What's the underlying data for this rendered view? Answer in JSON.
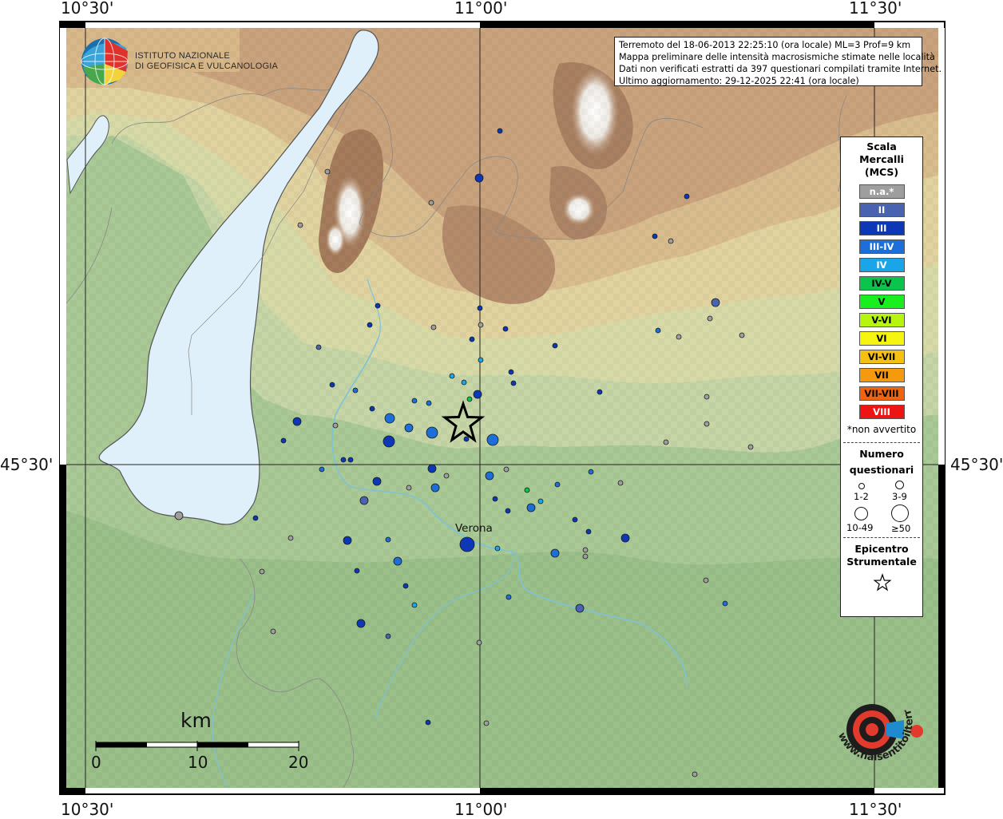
{
  "map": {
    "coords": {
      "top": [
        "10°30'",
        "11°00'",
        "11°30'"
      ],
      "bottom": [
        "10°30'",
        "11°00'",
        "11°30'"
      ],
      "left": "45°30'",
      "right": "45°30'"
    },
    "city": "Verona"
  },
  "logo": {
    "line1": "ISTITUTO NAZIONALE",
    "line2": "DI GEOFISICA E VULCANOLOGIA"
  },
  "info": {
    "line1": "Terremoto del 18-06-2013 22:25:10 (ora locale) ML=3 Prof=9 km",
    "line2": "Mappa preliminare delle intensità macrosismiche stimate nelle località",
    "line3": "Dati non verificati estratti da 397 questionari compilati tramite Internet.",
    "line4": "Ultimo aggiornamento: 29-12-2025 22:41 (ora locale)"
  },
  "legend": {
    "title": [
      "Scala",
      "Mercalli",
      "(MCS)"
    ],
    "scale": [
      {
        "label": "n.a.*",
        "color": "#9e9e9e",
        "text": "#ffffff"
      },
      {
        "label": "II",
        "color": "#4a63b0",
        "text": "#ffffff"
      },
      {
        "label": "III",
        "color": "#0c38b8",
        "text": "#ffffff"
      },
      {
        "label": "III-IV",
        "color": "#1c6fd8",
        "text": "#ffffff"
      },
      {
        "label": "IV",
        "color": "#19a5e8",
        "text": "#ffffff"
      },
      {
        "label": "IV-V",
        "color": "#0bc44c",
        "text": "#000000"
      },
      {
        "label": "V",
        "color": "#19ee1e",
        "text": "#000000"
      },
      {
        "label": "V-VI",
        "color": "#b6f510",
        "text": "#000000"
      },
      {
        "label": "VI",
        "color": "#f5f50f",
        "text": "#000000"
      },
      {
        "label": "VI-VII",
        "color": "#f5c00f",
        "text": "#000000"
      },
      {
        "label": "VII",
        "color": "#f59a0f",
        "text": "#000000"
      },
      {
        "label": "VII-VIII",
        "color": "#f0640f",
        "text": "#000000"
      },
      {
        "label": "VIII",
        "color": "#ee1414",
        "text": "#ffffff"
      }
    ],
    "note": "*non avvertito",
    "count_title": [
      "Numero",
      "questionari"
    ],
    "count_labels": [
      "1-2",
      "3-9",
      "10-49",
      "≥50"
    ],
    "epi_title": [
      "Epicentro",
      "Strumentale"
    ]
  },
  "scalebar": {
    "unit": "km",
    "ticks": [
      "0",
      "10",
      "20"
    ]
  },
  "badge": {
    "text": "www.haisentitoilterremoto.it"
  }
}
